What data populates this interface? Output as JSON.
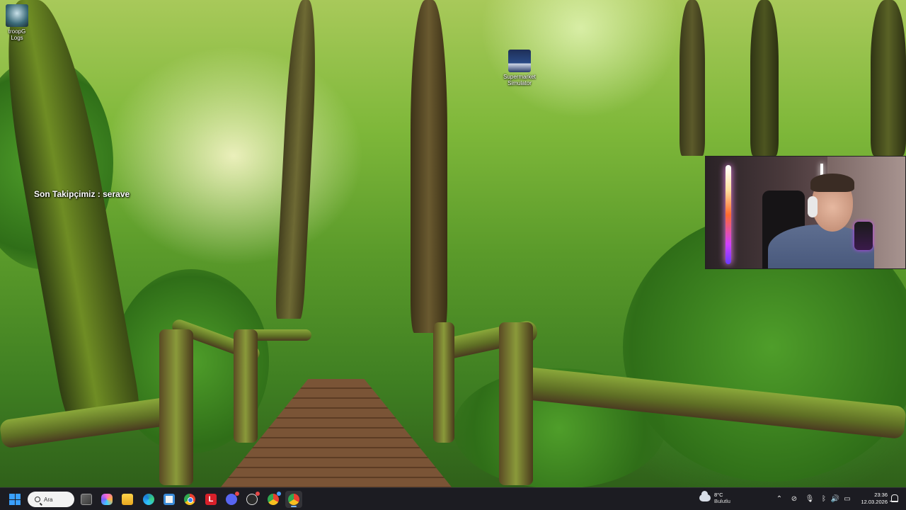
{
  "desktop": {
    "icons": [
      {
        "label": "troopG\nLogs",
        "icon": "app-logs-icon"
      },
      {
        "label": "Supermarket\nSimulator",
        "icon": "supermarket-simulator-icon"
      }
    ],
    "overlay_text": "Son Takipçimiz : serave"
  },
  "taskbar": {
    "search_label": "Ara",
    "apps": [
      {
        "name": "task-view",
        "icon": "task-view-icon"
      },
      {
        "name": "copilot",
        "icon": "copilot-icon"
      },
      {
        "name": "file-explorer",
        "icon": "folder-icon"
      },
      {
        "name": "edge",
        "icon": "edge-icon"
      },
      {
        "name": "microsoft-store",
        "icon": "store-icon"
      },
      {
        "name": "chrome",
        "icon": "chrome-icon"
      },
      {
        "name": "l-app",
        "icon": "l-icon",
        "glyph": "L"
      },
      {
        "name": "discord",
        "icon": "discord-icon"
      },
      {
        "name": "obs",
        "icon": "obs-icon"
      },
      {
        "name": "chrome-profile",
        "icon": "chrome-icon"
      },
      {
        "name": "chrome-active",
        "icon": "chrome-icon"
      }
    ],
    "weather": {
      "temp": "8°C",
      "desc": "Bulutlu"
    },
    "clock": {
      "time": "23:36",
      "date": "12.03.2026"
    }
  },
  "colors": {
    "taskbar_bg": "#1c1c22",
    "accent": "#3aa0ff"
  }
}
